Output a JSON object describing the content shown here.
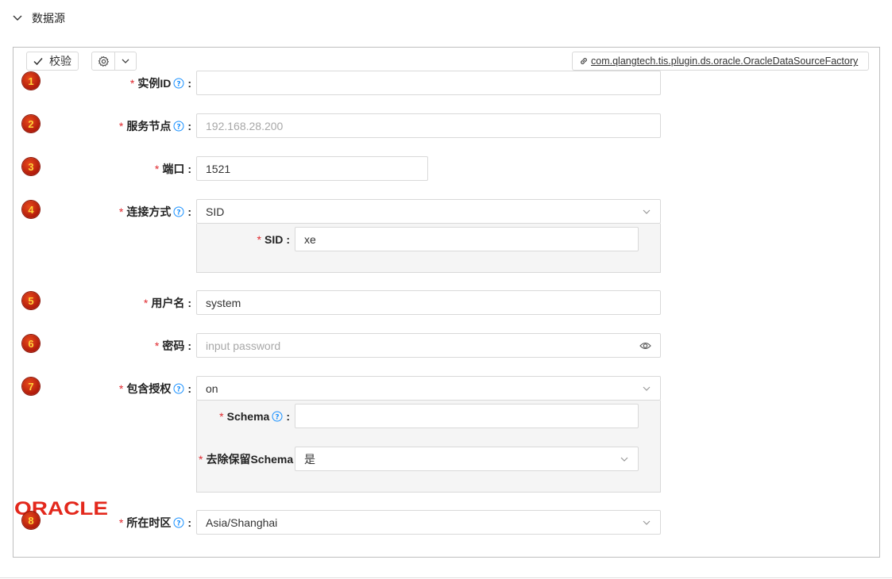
{
  "section": {
    "title": "数据源"
  },
  "toolbar": {
    "validate_label": "校验",
    "plugin_class": "com.qlangtech.tis.plugin.ds.oracle.OracleDataSourceFactory"
  },
  "badges": [
    "1",
    "2",
    "3",
    "4",
    "5",
    "6",
    "7",
    "8"
  ],
  "form": {
    "instance_id": {
      "label": "实例ID",
      "value": ""
    },
    "service_node": {
      "label": "服务节点",
      "placeholder": "192.168.28.200"
    },
    "port": {
      "label": "端口",
      "value": "1521"
    },
    "connect_mode": {
      "label": "连接方式",
      "value": "SID",
      "sid": {
        "label": "SID",
        "value": "xe"
      }
    },
    "username": {
      "label": "用户名",
      "value": "system"
    },
    "password": {
      "label": "密码",
      "placeholder": "input password"
    },
    "include_grant": {
      "label": "包含授权",
      "value": "on",
      "schema": {
        "label": "Schema",
        "value": ""
      },
      "remove_reserved_schema": {
        "label": "去除保留Schema",
        "value": "是"
      }
    },
    "timezone": {
      "label": "所在时区",
      "value": "Asia/Shanghai"
    }
  },
  "colors": {
    "required": "#e0282e",
    "help_icon": "#1890ff",
    "oracle_brand": "#e3281c",
    "badge": "#c4230e"
  },
  "icons": {
    "collapse": "chevron-down-icon",
    "validate": "check-icon",
    "settings": "gear-icon",
    "dropdown": "chevron-down-icon",
    "link": "link-icon",
    "help": "question-circle-icon",
    "password": "eye-icon"
  },
  "logo": {
    "text": "ORACLE"
  }
}
